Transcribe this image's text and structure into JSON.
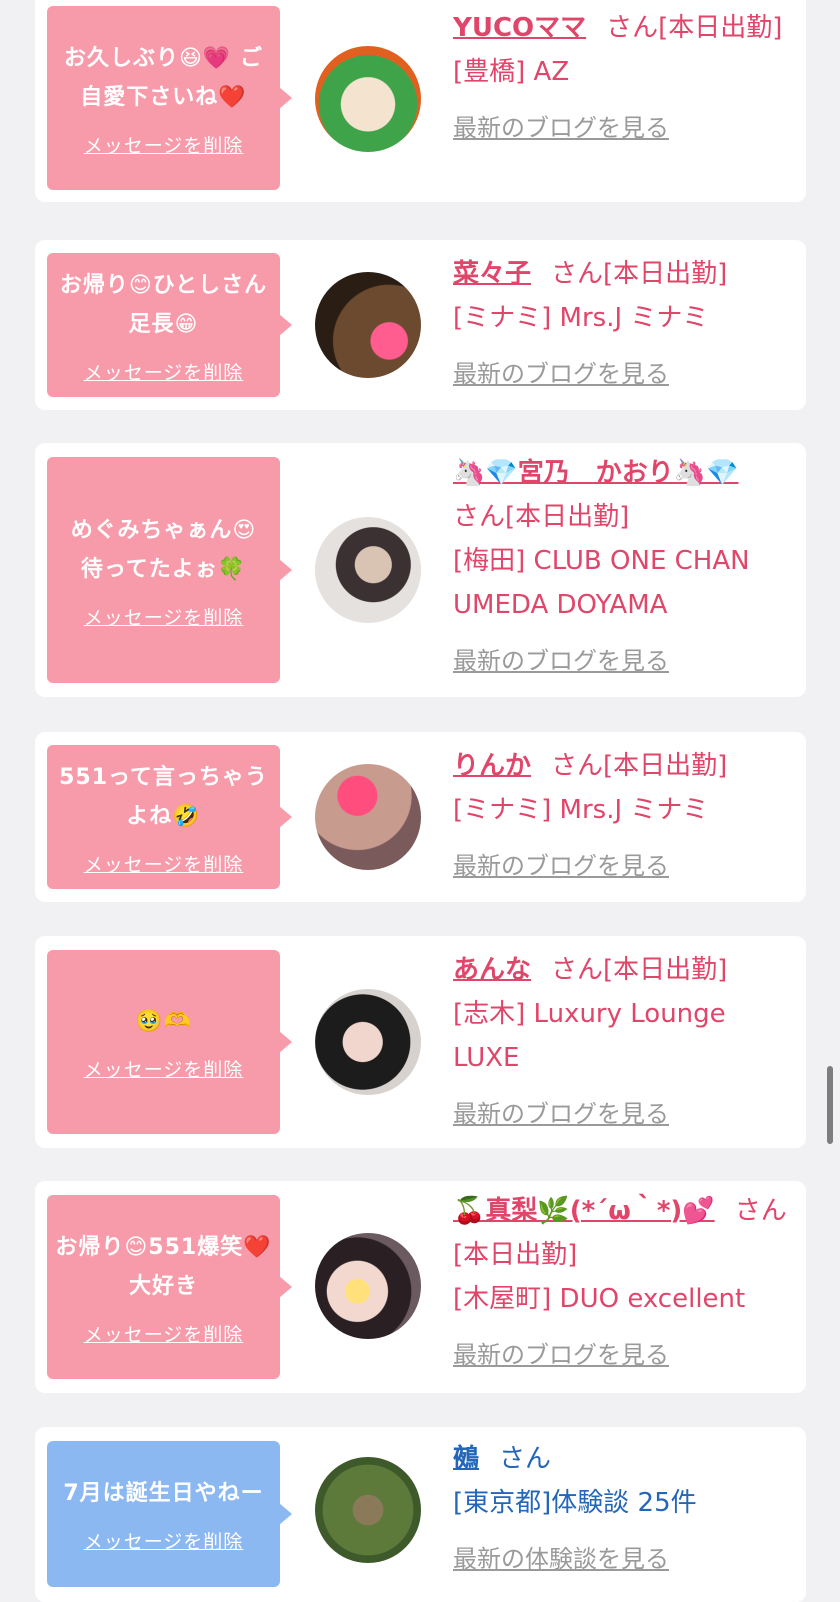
{
  "cards": [
    {
      "message": "お久しぶり😆💗 ご自愛下さいね❤️",
      "delete_label": "メッセージを削除",
      "name": "YUCOママ",
      "san": "さん[本日出勤]",
      "location": "[豊橋] AZ",
      "blog_label": "最新のブログを見る",
      "theme": "pink"
    },
    {
      "message": "お帰り😊ひとしさん足長😁",
      "delete_label": "メッセージを削除",
      "name": "菜々子",
      "san": "さん[本日出勤]",
      "location": "[ミナミ] Mrs.J ミナミ",
      "blog_label": "最新のブログを見る",
      "theme": "pink"
    },
    {
      "message": "めぐみちゃぁん😍 待ってたよぉ🍀",
      "delete_label": "メッセージを削除",
      "name": "🦄💎宮乃　かおり🦄💎",
      "san": "さん[本日出勤]",
      "location": "[梅田] CLUB ONE CHAN UMEDA DOYAMA",
      "blog_label": "最新のブログを見る",
      "theme": "pink"
    },
    {
      "message": "551って言っちゃうよね🤣",
      "delete_label": "メッセージを削除",
      "name": "りんか",
      "san": "さん[本日出勤]",
      "location": "[ミナミ] Mrs.J ミナミ",
      "blog_label": "最新のブログを見る",
      "theme": "pink"
    },
    {
      "message": "🥹🫶",
      "delete_label": "メッセージを削除",
      "name": "あんな",
      "san": "さん[本日出勤]",
      "location": "[志木] Luxury Lounge LUXE",
      "blog_label": "最新のブログを見る",
      "theme": "pink"
    },
    {
      "message": "お帰り😊551爆笑❤️大好き",
      "delete_label": "メッセージを削除",
      "name": "🍒真梨🌿(*´ω｀*)💕",
      "san": "さん[本日出勤]",
      "location": "[木屋町] DUO excellent",
      "blog_label": "最新のブログを見る",
      "theme": "pink"
    },
    {
      "message": "7月は誕生日やねー",
      "delete_label": "メッセージを削除",
      "name": "鵺",
      "san": "さん",
      "location": "[東京都]体験談 25件",
      "blog_label": "最新の体験談を見る",
      "theme": "blue"
    }
  ]
}
